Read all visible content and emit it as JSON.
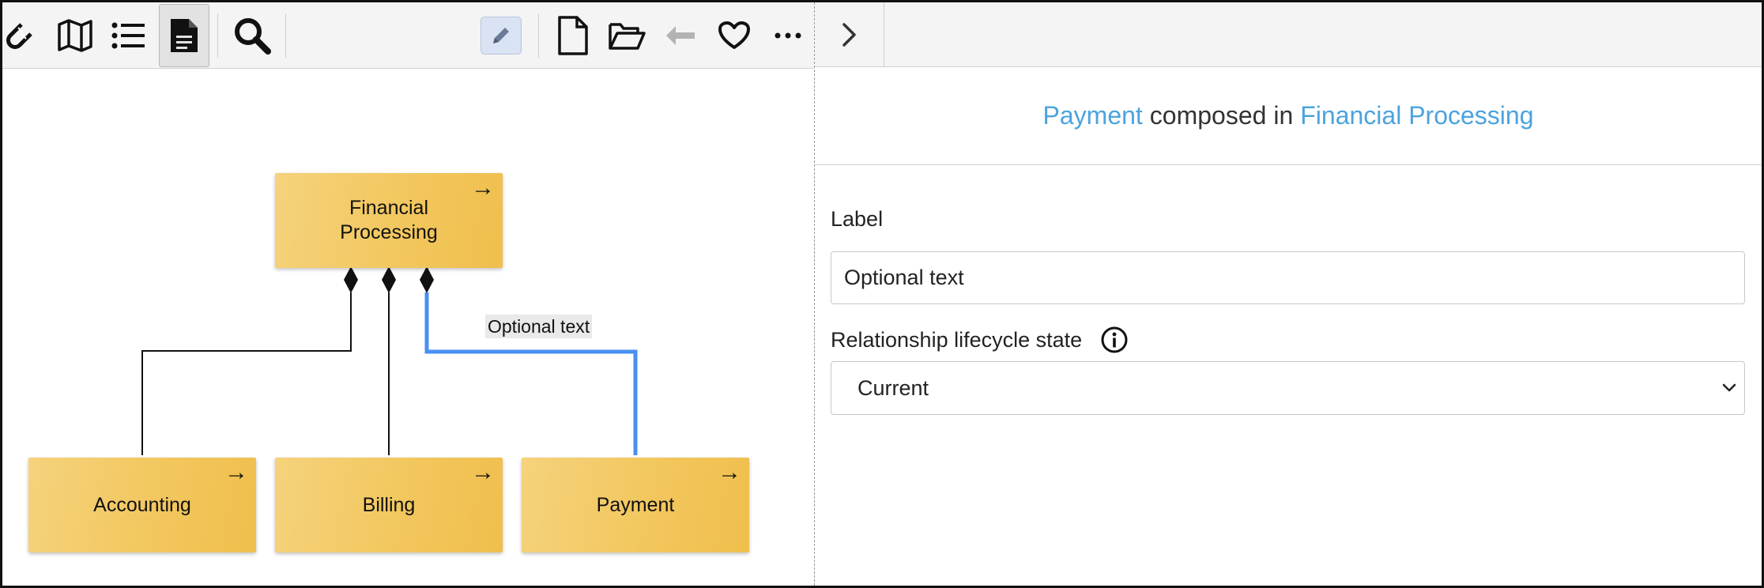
{
  "toolbar": {
    "tools": [
      {
        "name": "magnet-icon"
      },
      {
        "name": "map-icon"
      },
      {
        "name": "list-icon"
      },
      {
        "name": "document-icon",
        "active": true
      },
      {
        "name": "search-icon"
      },
      {
        "name": "pencil-icon",
        "active": true
      },
      {
        "name": "new-file-icon"
      },
      {
        "name": "open-folder-icon"
      },
      {
        "name": "undo-icon",
        "disabled": true
      },
      {
        "name": "heart-icon"
      },
      {
        "name": "more-icon"
      }
    ]
  },
  "diagram": {
    "nodes": [
      {
        "id": "financial-processing",
        "label": "Financial Processing",
        "label_lines": [
          "Financial",
          "Processing"
        ],
        "arrow": "→"
      },
      {
        "id": "accounting",
        "label": "Accounting",
        "arrow": "→"
      },
      {
        "id": "billing",
        "label": "Billing",
        "arrow": "→"
      },
      {
        "id": "payment",
        "label": "Payment",
        "arrow": "→"
      }
    ],
    "edges": [
      {
        "from": "accounting",
        "to": "financial-processing",
        "type": "composition"
      },
      {
        "from": "billing",
        "to": "financial-processing",
        "type": "composition"
      },
      {
        "from": "payment",
        "to": "financial-processing",
        "type": "composition",
        "selected": true,
        "label": "Optional text"
      }
    ]
  },
  "colors": {
    "node_fill": "#f2c75e",
    "selected_edge": "#4a8ff0",
    "link": "#4ca3de",
    "edit_button": "#d9e3f3"
  },
  "panel": {
    "collapse_icon": "chevron-right-icon",
    "heading": {
      "source": "Payment",
      "relation": "composed in",
      "target": "Financial Processing"
    },
    "label_field": {
      "label": "Label",
      "value": "Optional text"
    },
    "lifecycle": {
      "label": "Relationship lifecycle state",
      "info_icon": "info-icon",
      "value": "Current"
    }
  }
}
